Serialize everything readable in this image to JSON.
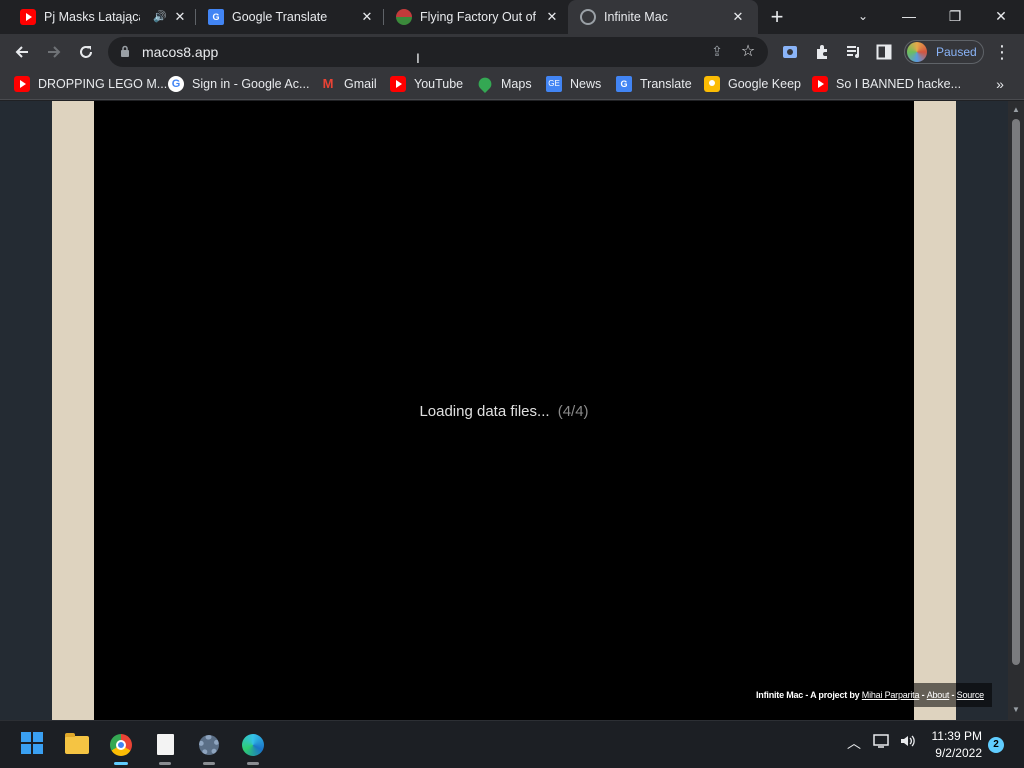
{
  "browser": {
    "tabs": [
      {
        "title": "Pj Masks Latająca f",
        "favicon": "youtube-icon",
        "audio": true
      },
      {
        "title": "Google Translate",
        "favicon": "google-translate-icon"
      },
      {
        "title": "Flying Factory Out of C",
        "favicon": "flying-factory-icon"
      },
      {
        "title": "Infinite Mac",
        "favicon": "globe-icon",
        "active": true
      }
    ],
    "new_tab_label": "+",
    "url": "macos8.app",
    "profile_label": "Paused",
    "bookmarks": [
      {
        "label": "DROPPING LEGO M...",
        "icon": "youtube-icon"
      },
      {
        "label": "Sign in - Google Ac...",
        "icon": "google-icon"
      },
      {
        "label": "Gmail",
        "icon": "gmail-icon"
      },
      {
        "label": "YouTube",
        "icon": "youtube-icon"
      },
      {
        "label": "Maps",
        "icon": "maps-icon"
      },
      {
        "label": "News",
        "icon": "news-icon"
      },
      {
        "label": "Translate",
        "icon": "google-translate-icon"
      },
      {
        "label": "Google Keep",
        "icon": "keep-icon"
      },
      {
        "label": "So I BANNED hacke...",
        "icon": "youtube-icon"
      }
    ]
  },
  "page": {
    "loading_text": "Loading data files...",
    "loading_progress": "(4/4)",
    "footer": {
      "prefix": "Infinite Mac - A project by",
      "author": "Mihai Parparita",
      "sep1": " - ",
      "about": "About",
      "sep2": " - ",
      "source": "Source"
    }
  },
  "taskbar": {
    "time": "11:39 PM",
    "date": "9/2/2022",
    "notification_count": "2"
  },
  "colors": {
    "page_bg": "#242b33",
    "bezel": "#ded3bf",
    "screen": "#000000",
    "accent": "#60cdff"
  }
}
